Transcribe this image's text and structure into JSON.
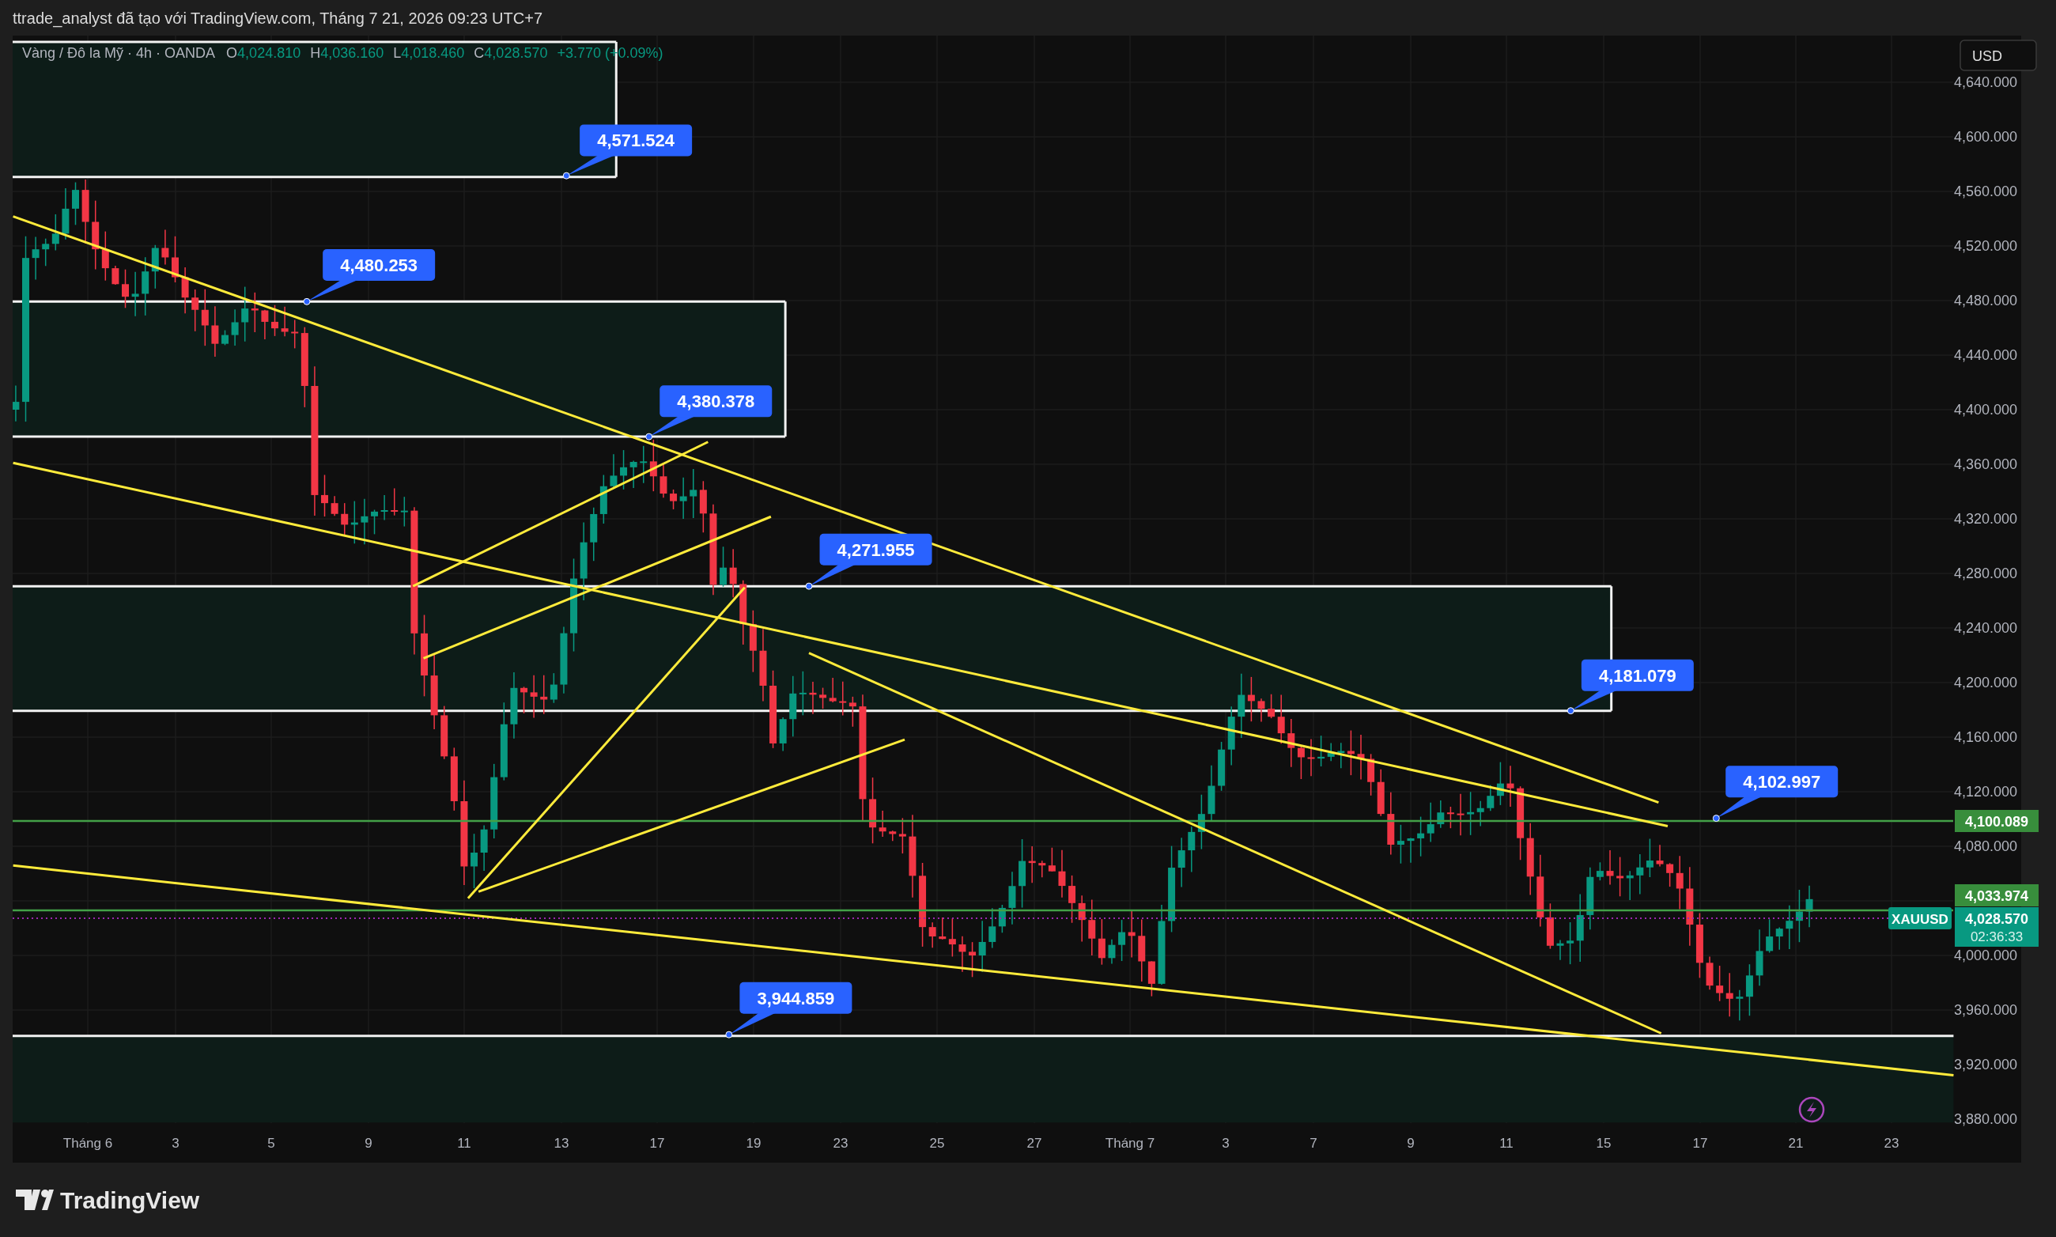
{
  "header": {
    "title": "ttrade_analyst đã tạo với TradingView.com, Tháng 7 21, 2026 09:23 UTC+7"
  },
  "legend": {
    "symbol": "Vàng / Đô la Mỹ · 4h · OANDA",
    "ohlc": [
      {
        "label": "O",
        "value": "4,024.810"
      },
      {
        "label": "H",
        "value": "4,036.160"
      },
      {
        "label": "L",
        "value": "4,018.460"
      },
      {
        "label": "C",
        "value": "4,028.570"
      }
    ],
    "change": "+3.770 (+0.09%)"
  },
  "currency_button": "USD",
  "price_axis": {
    "ticks": [
      "4,640.000",
      "4,600.000",
      "4,560.000",
      "4,520.000",
      "4,480.000",
      "4,440.000",
      "4,400.000",
      "4,360.000",
      "4,320.000",
      "4,280.000",
      "4,240.000",
      "4,200.000",
      "4,160.000",
      "4,120.000",
      "4,080.000",
      "4,000.000",
      "3,960.000",
      "3,920.000",
      "3,880.000"
    ]
  },
  "time_axis": {
    "labels": [
      "Tháng 6",
      "3",
      "5",
      "9",
      "11",
      "13",
      "17",
      "19",
      "23",
      "25",
      "27",
      "Tháng 7",
      "3",
      "7",
      "9",
      "11",
      "15",
      "17",
      "21",
      "23"
    ]
  },
  "callouts": [
    "4,571.524",
    "4,480.253",
    "4,380.378",
    "4,271.955",
    "4,181.079",
    "4,102.997",
    "3,944.859"
  ],
  "price_badges": [
    {
      "kind": "level",
      "text": "4,100.089"
    },
    {
      "kind": "level",
      "text": "4,033.974"
    },
    {
      "kind": "last",
      "text": "4,028.570",
      "countdown": "02:36:33",
      "symbol": "XAUUSD"
    }
  ],
  "footer": {
    "brand": "TradingView"
  }
}
